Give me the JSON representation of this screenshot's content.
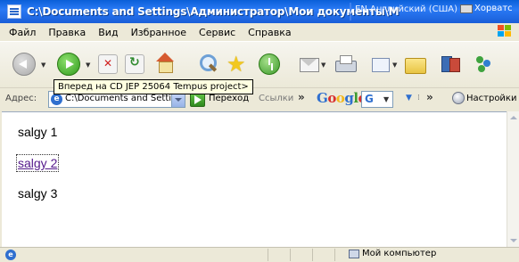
{
  "window": {
    "title": "C:\\Documents and Settings\\Администратор\\Мои документы\\М",
    "language_indicator": "EN Английский (США)",
    "keyboard_label": "Хорватс"
  },
  "menu": {
    "items": [
      "Файл",
      "Правка",
      "Вид",
      "Избранное",
      "Сервис",
      "Справка"
    ]
  },
  "toolbar": {
    "tooltip": "Вперед на CD JEP 25064 Tempus project>"
  },
  "address_bar": {
    "label": "Адрес:",
    "value": "C:\\Documents and Setting",
    "go_label": "Переход",
    "links_label": "Ссылки",
    "google_logo": "Google",
    "google_button_letter": "G",
    "settings_label": "Настройки"
  },
  "content": {
    "items": [
      {
        "text": "salgy 1",
        "is_link": false
      },
      {
        "text": "salgy 2",
        "is_link": true
      },
      {
        "text": "salgy 3",
        "is_link": false
      }
    ]
  },
  "status_bar": {
    "zone": "Мой компьютер"
  },
  "icons": {
    "back": "back-icon",
    "forward": "forward-icon",
    "stop": "stop-icon",
    "refresh": "refresh-icon",
    "home": "home-icon",
    "search": "search-icon",
    "favorites": "favorites-icon",
    "history": "history-icon",
    "mail": "mail-icon",
    "print": "print-icon",
    "edit": "edit-icon",
    "folder": "folder-icon",
    "research": "research-icon",
    "messenger": "messenger-icon"
  },
  "colors": {
    "titlebar": "#0a5fd8",
    "visited_link": "#551a8b",
    "tooltip_bg": "#ffffe1"
  }
}
